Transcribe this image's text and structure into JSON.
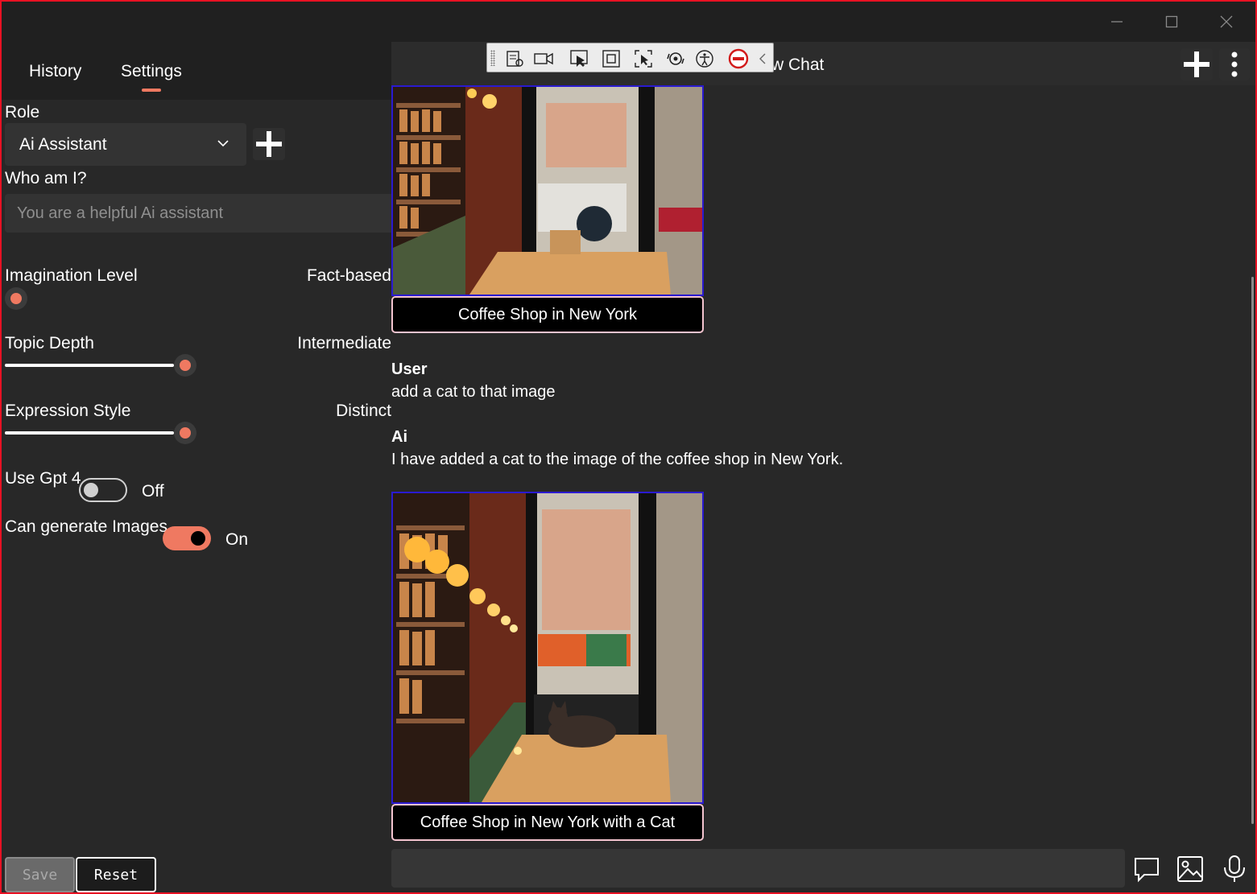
{
  "window": {
    "controls": [
      "minimize",
      "maximize",
      "close"
    ]
  },
  "tabs": [
    {
      "label": "History",
      "selected": false
    },
    {
      "label": "Settings",
      "selected": true
    }
  ],
  "settings": {
    "role_label": "Role",
    "role_value": "Ai Assistant",
    "who_label": "Who am I?",
    "who_placeholder": "You are a helpful Ai assistant",
    "imagination_label": "Imagination Level",
    "imagination_value_text": "Fact-based",
    "imagination_fraction": 0.0,
    "topic_label": "Topic Depth",
    "topic_value_text": "Intermediate",
    "topic_fraction": 0.93,
    "expression_label": "Expression Style",
    "expression_value_text": "Distinct",
    "expression_fraction": 0.93,
    "gpt4_label": "Use Gpt 4",
    "gpt4_state": "Off",
    "images_label": "Can generate Images",
    "images_state": "On",
    "save_label": "Save",
    "reset_label": "Reset"
  },
  "chat": {
    "title": "w Chat",
    "messages": [
      {
        "type": "image",
        "caption": "Coffee Shop in New York"
      },
      {
        "type": "text",
        "sender": "User",
        "text": "add a cat to that image"
      },
      {
        "type": "text",
        "sender": "Ai",
        "text": "I have added a cat to the image of the coffee shop in New York."
      },
      {
        "type": "image",
        "caption": "Coffee Shop in New York with a Cat"
      }
    ],
    "input_value": ""
  },
  "toolbar_icons": [
    "live-tree-icon",
    "record-icon",
    "select-element-icon",
    "display-layout-adorners-icon",
    "track-focus-icon",
    "hot-reload-icon",
    "accessibility-icon",
    "binding-failures-icon",
    "collapse-icon"
  ],
  "colors": {
    "accent": "#ef7961",
    "background": "#282828",
    "image_border": "#2a1ad0",
    "caption_border": "#f3c4cf"
  }
}
